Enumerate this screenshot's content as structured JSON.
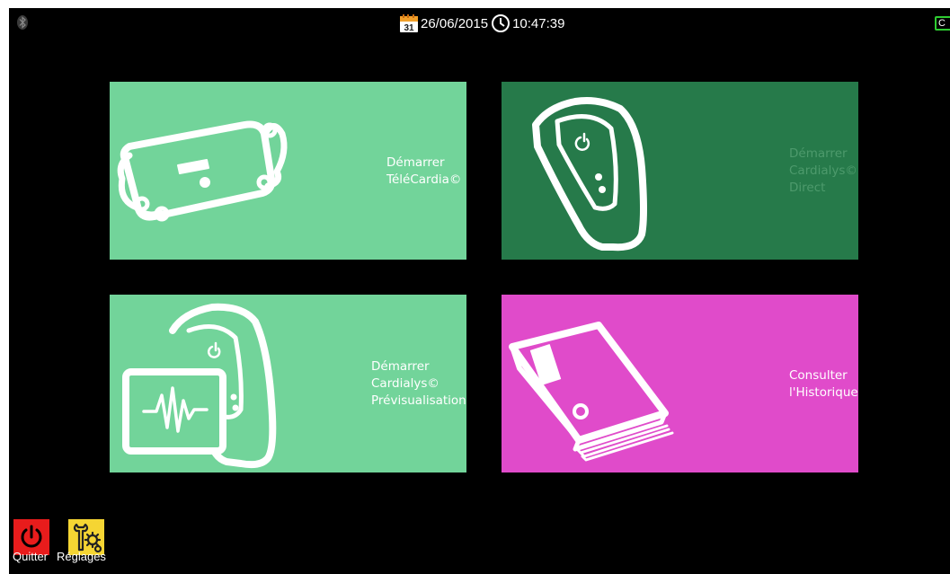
{
  "statusbar": {
    "date": "26/06/2015",
    "time": "10:47:39",
    "calendar_day": "31",
    "battery_label": "C"
  },
  "tiles": [
    {
      "label": "Démarrer\nTéléCardia©",
      "color": "#72d49a",
      "text_color": "#ffffff"
    },
    {
      "label": "Démarrer\nCardialys©\nDirect",
      "color": "#267a4a",
      "text_color": "#4d9a6c"
    },
    {
      "label": "Démarrer\nCardialys©\nPrévisualisation",
      "color": "#72d49a",
      "text_color": "#ffffff"
    },
    {
      "label": "Consulter\nl'Historique",
      "color": "#e04bca",
      "text_color": "#ffffff"
    }
  ],
  "bottom": {
    "quit_label": "Quitter",
    "settings_label": "Réglages"
  }
}
